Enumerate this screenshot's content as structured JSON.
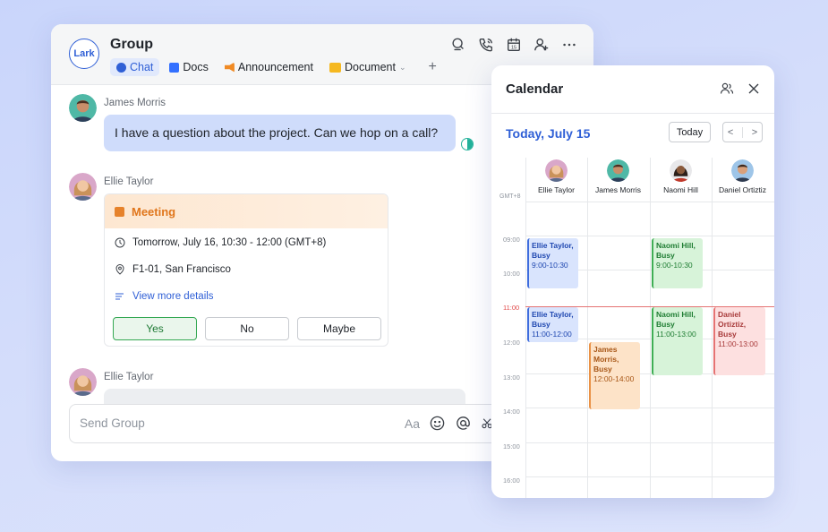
{
  "chat": {
    "logo": "Lark",
    "title": "Group",
    "tabs": [
      {
        "label": "Chat",
        "icon": "chat-icon",
        "active": true
      },
      {
        "label": "Docs",
        "icon": "docs-icon"
      },
      {
        "label": "Announcement",
        "icon": "megaphone-icon"
      },
      {
        "label": "Document",
        "icon": "folder-icon",
        "dropdown": true
      }
    ],
    "add_tab": "+",
    "header_icons": [
      "search-icon",
      "phone-icon",
      "calendar-icon",
      "add-member-icon",
      "more-icon"
    ],
    "messages": [
      {
        "sender": "James Morris",
        "text": "I have a question about the project. Can we hop on a call?"
      },
      {
        "sender": "Ellie Taylor",
        "card": {
          "title": "Meeting",
          "time": "Tomorrow, July 16, 10:30 - 12:00 (GMT+8)",
          "location": "F1-01, San Francisco",
          "details_link": "View more details",
          "buttons": [
            "Yes",
            "No",
            "Maybe"
          ],
          "selected": "Yes"
        }
      },
      {
        "sender": "Ellie Taylor",
        "text": ""
      }
    ],
    "composer": {
      "placeholder": "Send Group",
      "font_label": "Aa"
    }
  },
  "calendar": {
    "title": "Calendar",
    "date": "Today, July 15",
    "today_button": "Today",
    "nav_prev": "<",
    "nav_next": ">",
    "timezone": "GMT+8",
    "people": [
      "Ellie Taylor",
      "James Morris",
      "Naomi Hill",
      "Daniel Ortiztiz"
    ],
    "hours": [
      "09:00",
      "10:00",
      "11:00",
      "12:00",
      "13:00",
      "14:00",
      "15:00",
      "16:00"
    ],
    "now_time": "11:00",
    "events": [
      {
        "name": "Ellie Taylor, Busy",
        "time": "9:00-10:30",
        "color": "#3f6ddd"
      },
      {
        "name": "Ellie Taylor, Busy",
        "time": "11:00-12:00",
        "color": "#3f6ddd"
      },
      {
        "name": "James Morris, Busy",
        "time": "12:00-14:00",
        "color": "#ea9246"
      },
      {
        "name": "Naomi Hill, Busy",
        "time": "9:00-10:30",
        "color": "#3fae55"
      },
      {
        "name": "Naomi Hill, Busy",
        "time": "11:00-13:00",
        "color": "#3fae55"
      },
      {
        "name": "Daniel Ortiztiz, Busy",
        "time": "11:00-13:00",
        "color": "#e57373"
      }
    ]
  },
  "colors": {
    "accent": "#2f5fd6",
    "bubble": "#cfdcfb",
    "meeting": "#e0761c",
    "now_line": "#e04747"
  }
}
